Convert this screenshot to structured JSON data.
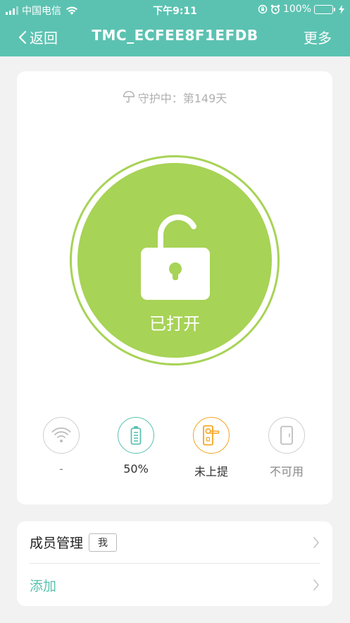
{
  "status_bar": {
    "carrier": "中国电信",
    "time": "下午9:11",
    "battery_percent": "100%"
  },
  "nav": {
    "back_label": "返回",
    "title": "TMC_ECFEE8F1EFDB",
    "more_label": "更多"
  },
  "guard": {
    "text": "守护中：第149天"
  },
  "lock": {
    "state_label": "已打开"
  },
  "features": [
    {
      "label": "-",
      "icon": "wifi-icon"
    },
    {
      "label": "50%",
      "icon": "battery-icon"
    },
    {
      "label": "未上提",
      "icon": "door-handle-icon"
    },
    {
      "label": "不可用",
      "icon": "door-icon"
    }
  ],
  "members": {
    "title": "成员管理",
    "badge": "我",
    "add_label": "添加"
  },
  "colors": {
    "header": "#5bc2b1",
    "lock_green": "#a7d356",
    "teal": "#5bc2b1",
    "orange": "#f5a623"
  }
}
